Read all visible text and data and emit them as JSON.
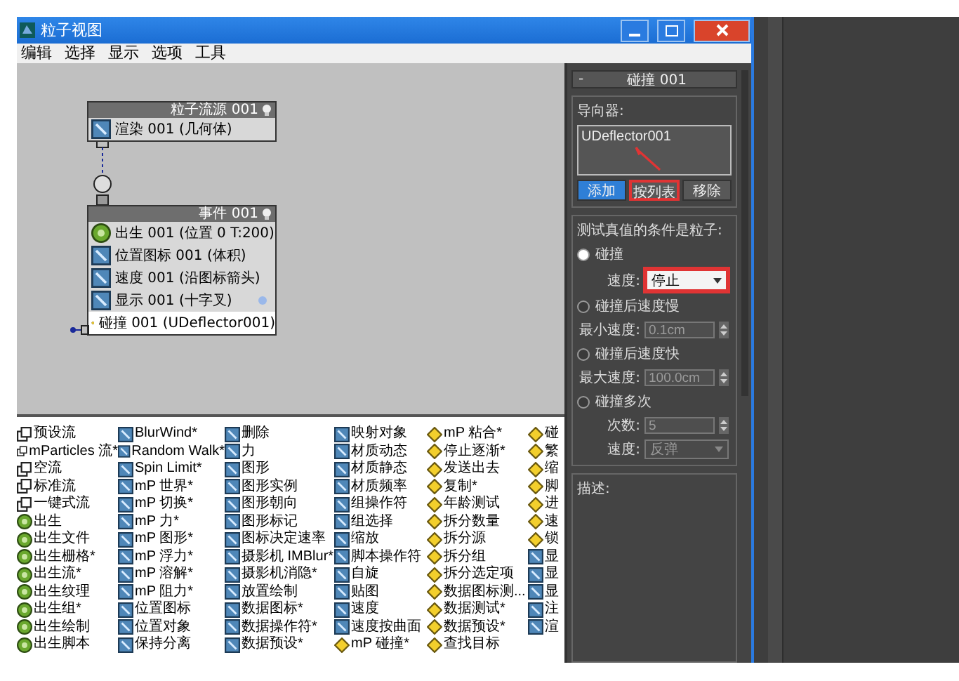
{
  "window": {
    "title": "粒子视图"
  },
  "menu": [
    "编辑",
    "选择",
    "显示",
    "选项",
    "工具"
  ],
  "graph": {
    "nodes": [
      {
        "title": "粒子流源 001",
        "kind": "source",
        "operators": [
          {
            "label": "渲染 001 (几何体)",
            "kind": "render",
            "selected": false
          }
        ]
      },
      {
        "title": "事件 001",
        "kind": "event",
        "operators": [
          {
            "label": "出生 001 (位置 0 T:200)",
            "kind": "birth",
            "selected": false
          },
          {
            "label": "位置图标 001 (体积)",
            "kind": "position",
            "selected": false
          },
          {
            "label": "速度 001 (沿图标箭头)",
            "kind": "speed",
            "selected": false
          },
          {
            "label": "显示 001 (十字叉)",
            "kind": "display",
            "selected": false,
            "color": "#9ab8ea"
          },
          {
            "label": "碰撞 001 (UDeflector001)",
            "kind": "test",
            "selected": true
          }
        ]
      }
    ]
  },
  "panel": {
    "rollout": "碰撞 001",
    "collapse": "-",
    "deflectors": {
      "label": "导向器:",
      "items": [
        "UDeflector001"
      ],
      "buttons": [
        {
          "label": "添加",
          "selected": true,
          "highlighted": false
        },
        {
          "label": "按列表",
          "selected": false,
          "highlighted": true
        },
        {
          "label": "移除",
          "selected": false,
          "highlighted": false
        }
      ]
    },
    "conditions": {
      "label": "测试真值的条件是粒子:",
      "options": [
        {
          "label": "碰撞",
          "selected": true,
          "fields": [
            {
              "label": "速度:",
              "kind": "dropdown",
              "value": "停止",
              "disabled": false,
              "highlighted": true
            }
          ]
        },
        {
          "label": "碰撞后速度慢",
          "selected": false,
          "fields": [
            {
              "label": "最小速度:",
              "kind": "spinner",
              "value": "0.1cm",
              "disabled": true
            }
          ]
        },
        {
          "label": "碰撞后速度快",
          "selected": false,
          "fields": [
            {
              "label": "最大速度:",
              "kind": "spinner",
              "value": "100.0cm",
              "disabled": true
            }
          ]
        },
        {
          "label": "碰撞多次",
          "selected": false,
          "fields": [
            {
              "label": "次数:",
              "kind": "spinner",
              "value": "5",
              "disabled": true
            },
            {
              "label": "速度:",
              "kind": "dropdown",
              "value": "反弹",
              "disabled": true,
              "highlighted": false
            }
          ]
        }
      ]
    },
    "description": {
      "label": "描述:"
    }
  },
  "depot": {
    "columns": [
      [
        {
          "label": "预设流",
          "kind": "flow"
        },
        {
          "label": "mParticles 流*",
          "kind": "flow"
        },
        {
          "label": "空流",
          "kind": "flow"
        },
        {
          "label": "标准流",
          "kind": "flow"
        },
        {
          "label": "一键式流",
          "kind": "flow"
        },
        {
          "label": "出生",
          "kind": "birth"
        },
        {
          "label": "出生文件",
          "kind": "birth"
        },
        {
          "label": "出生栅格*",
          "kind": "birth"
        },
        {
          "label": "出生流*",
          "kind": "birth"
        },
        {
          "label": "出生纹理",
          "kind": "birth"
        },
        {
          "label": "出生组*",
          "kind": "birth"
        },
        {
          "label": "出生绘制",
          "kind": "birth"
        },
        {
          "label": "出生脚本",
          "kind": "birth"
        }
      ],
      [
        {
          "label": "BlurWind*",
          "kind": "operator"
        },
        {
          "label": "Random Walk*",
          "kind": "operator"
        },
        {
          "label": "Spin Limit*",
          "kind": "operator"
        },
        {
          "label": "mP 世界*",
          "kind": "operator"
        },
        {
          "label": "mP 切换*",
          "kind": "operator"
        },
        {
          "label": "mP 力*",
          "kind": "operator"
        },
        {
          "label": "mP 图形*",
          "kind": "operator"
        },
        {
          "label": "mP 浮力*",
          "kind": "operator"
        },
        {
          "label": "mP 溶解*",
          "kind": "operator"
        },
        {
          "label": "mP 阻力*",
          "kind": "operator"
        },
        {
          "label": "位置图标",
          "kind": "operator"
        },
        {
          "label": "位置对象",
          "kind": "operator"
        },
        {
          "label": "保持分离",
          "kind": "operator"
        }
      ],
      [
        {
          "label": "删除",
          "kind": "operator"
        },
        {
          "label": "力",
          "kind": "operator"
        },
        {
          "label": "图形",
          "kind": "operator"
        },
        {
          "label": "图形实例",
          "kind": "operator"
        },
        {
          "label": "图形朝向",
          "kind": "operator"
        },
        {
          "label": "图形标记",
          "kind": "operator"
        },
        {
          "label": "图标决定速率",
          "kind": "operator"
        },
        {
          "label": "摄影机 IMBlur*",
          "kind": "operator"
        },
        {
          "label": "摄影机消隐*",
          "kind": "operator"
        },
        {
          "label": "放置绘制",
          "kind": "operator"
        },
        {
          "label": "数据图标*",
          "kind": "operator"
        },
        {
          "label": "数据操作符*",
          "kind": "operator"
        },
        {
          "label": "数据预设*",
          "kind": "operator"
        }
      ],
      [
        {
          "label": "映射对象",
          "kind": "operator"
        },
        {
          "label": "材质动态",
          "kind": "operator"
        },
        {
          "label": "材质静态",
          "kind": "operator"
        },
        {
          "label": "材质频率",
          "kind": "operator"
        },
        {
          "label": "组操作符",
          "kind": "operator"
        },
        {
          "label": "组选择",
          "kind": "operator"
        },
        {
          "label": "缩放",
          "kind": "operator"
        },
        {
          "label": "脚本操作符",
          "kind": "operator"
        },
        {
          "label": "自旋",
          "kind": "operator"
        },
        {
          "label": "贴图",
          "kind": "operator"
        },
        {
          "label": "速度",
          "kind": "operator"
        },
        {
          "label": "速度按曲面",
          "kind": "operator"
        },
        {
          "label": "mP 碰撞*",
          "kind": "test"
        }
      ],
      [
        {
          "label": "mP 粘合*",
          "kind": "test"
        },
        {
          "label": "停止逐渐*",
          "kind": "test"
        },
        {
          "label": "发送出去",
          "kind": "test"
        },
        {
          "label": "复制*",
          "kind": "test"
        },
        {
          "label": "年龄测试",
          "kind": "test"
        },
        {
          "label": "拆分数量",
          "kind": "test"
        },
        {
          "label": "拆分源",
          "kind": "test"
        },
        {
          "label": "拆分组",
          "kind": "test"
        },
        {
          "label": "拆分选定项",
          "kind": "test"
        },
        {
          "label": "数据图标测...",
          "kind": "test"
        },
        {
          "label": "数据测试*",
          "kind": "test"
        },
        {
          "label": "数据预设*",
          "kind": "test"
        },
        {
          "label": "查找目标",
          "kind": "test"
        }
      ],
      [
        {
          "label": "碰",
          "kind": "test"
        },
        {
          "label": "繁",
          "kind": "test"
        },
        {
          "label": "缩",
          "kind": "test"
        },
        {
          "label": "脚",
          "kind": "test"
        },
        {
          "label": "进",
          "kind": "test"
        },
        {
          "label": "速",
          "kind": "test"
        },
        {
          "label": "锁",
          "kind": "test"
        },
        {
          "label": "显",
          "kind": "operator"
        },
        {
          "label": "显",
          "kind": "operator"
        },
        {
          "label": "显",
          "kind": "operator"
        },
        {
          "label": "注",
          "kind": "operator"
        },
        {
          "label": "渲",
          "kind": "operator"
        }
      ]
    ]
  }
}
